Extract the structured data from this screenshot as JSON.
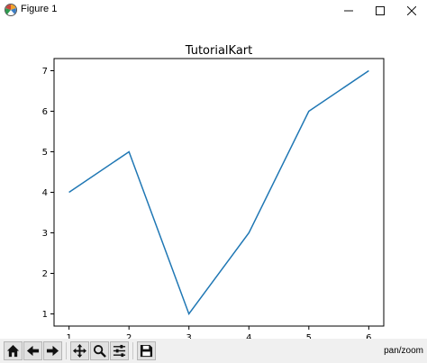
{
  "window": {
    "title": "Figure 1",
    "app_icon": "matplotlib-icon",
    "controls": [
      "minimize-icon",
      "maximize-icon",
      "close-icon"
    ]
  },
  "toolbar": {
    "buttons": [
      "home-icon",
      "back-icon",
      "forward-icon",
      "pan-icon",
      "zoom-icon",
      "subplots-icon",
      "save-icon"
    ],
    "status_text": "pan/zoom"
  },
  "chart_data": {
    "type": "line",
    "title": "TutorialKart",
    "xlabel": "",
    "ylabel": "",
    "x": [
      1,
      2,
      3,
      4,
      5,
      6
    ],
    "series": [
      {
        "values": [
          4,
          5,
          1,
          3,
          6,
          7
        ],
        "color": "#1f77b4"
      }
    ],
    "xlim": [
      0.75,
      6.25
    ],
    "ylim": [
      0.7,
      7.3
    ],
    "xticks": [
      "1",
      "2",
      "3",
      "4",
      "5",
      "6"
    ],
    "yticks": [
      "1",
      "2",
      "3",
      "4",
      "5",
      "6",
      "7"
    ],
    "grid": false
  }
}
